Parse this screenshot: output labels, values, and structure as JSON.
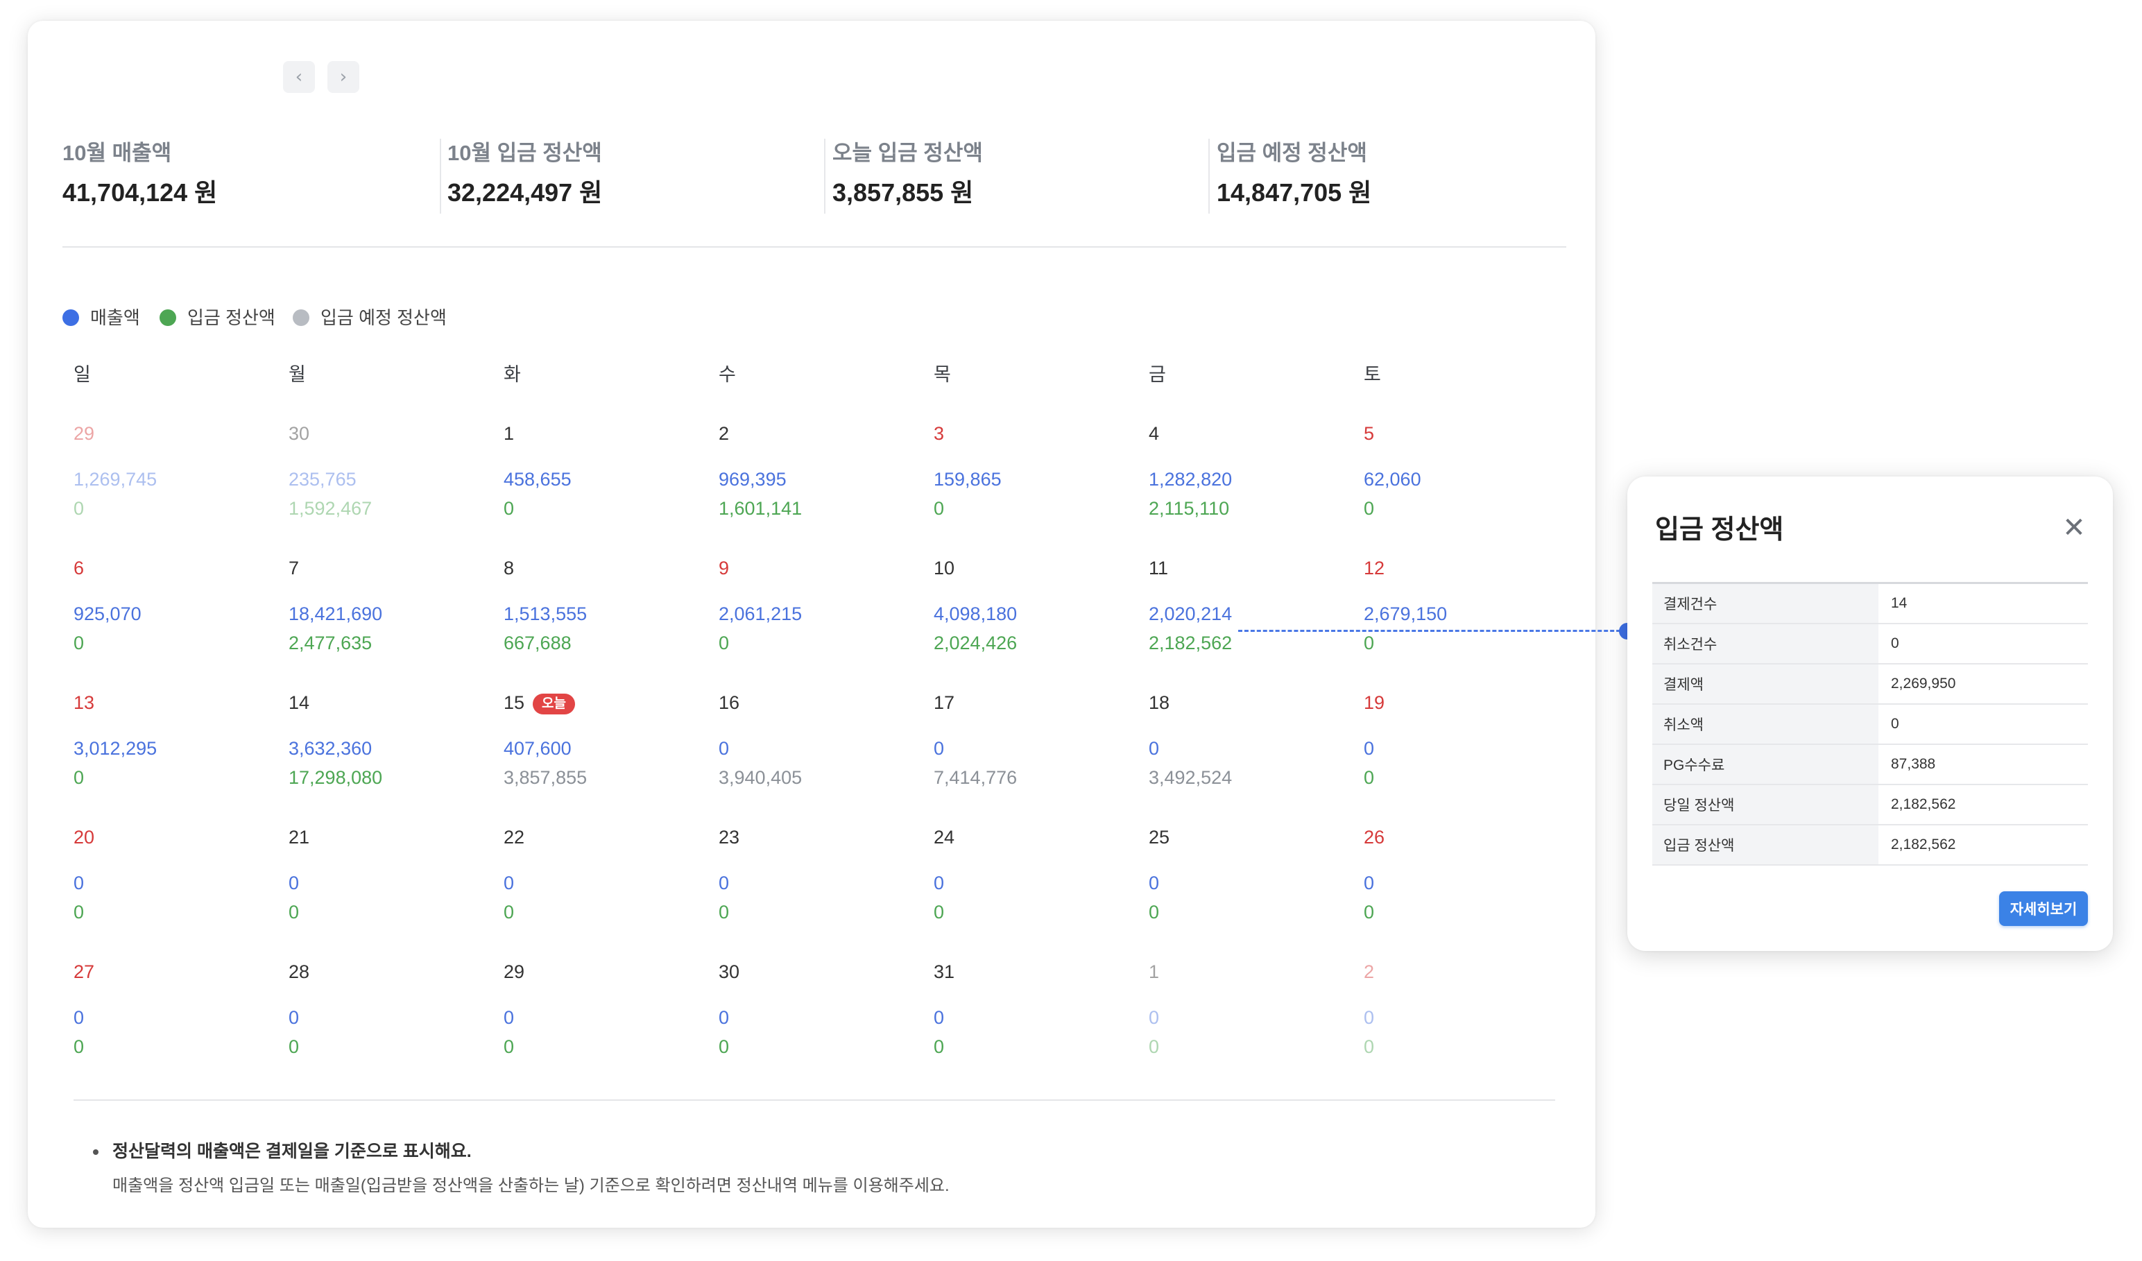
{
  "nav": {
    "prev": "‹",
    "next": "›"
  },
  "summary": [
    {
      "label": "10월 매출액",
      "value": "41,704,124 원"
    },
    {
      "label": "10월 입금 정산액",
      "value": "32,224,497 원"
    },
    {
      "label": "오늘 입금 정산액",
      "value": "3,857,855 원"
    },
    {
      "label": "입금 예정 정산액",
      "value": "14,847,705 원"
    }
  ],
  "legend": [
    {
      "label": "매출액",
      "color": "#3d6fe4"
    },
    {
      "label": "입금 정산액",
      "color": "#4da653"
    },
    {
      "label": "입금 예정 정산액",
      "color": "#b8bcc2"
    }
  ],
  "weekdays": [
    "일",
    "월",
    "화",
    "수",
    "목",
    "금",
    "토"
  ],
  "today_badge": "오늘",
  "weeks": [
    [
      {
        "day": "29",
        "sales": "1,269,745",
        "deposit": "0",
        "other": true
      },
      {
        "day": "30",
        "sales": "235,765",
        "deposit": "1,592,467",
        "other": true
      },
      {
        "day": "1",
        "sales": "458,655",
        "deposit": "0"
      },
      {
        "day": "2",
        "sales": "969,395",
        "deposit": "1,601,141"
      },
      {
        "day": "3",
        "sales": "159,865",
        "deposit": "0",
        "holiday": true
      },
      {
        "day": "4",
        "sales": "1,282,820",
        "deposit": "2,115,110"
      },
      {
        "day": "5",
        "sales": "62,060",
        "deposit": "0"
      }
    ],
    [
      {
        "day": "6",
        "sales": "925,070",
        "deposit": "0"
      },
      {
        "day": "7",
        "sales": "18,421,690",
        "deposit": "2,477,635"
      },
      {
        "day": "8",
        "sales": "1,513,555",
        "deposit": "667,688"
      },
      {
        "day": "9",
        "sales": "2,061,215",
        "deposit": "0",
        "holiday": true
      },
      {
        "day": "10",
        "sales": "4,098,180",
        "deposit": "2,024,426"
      },
      {
        "day": "11",
        "sales": "2,020,214",
        "deposit": "2,182,562"
      },
      {
        "day": "12",
        "sales": "2,679,150",
        "deposit": "0"
      }
    ],
    [
      {
        "day": "13",
        "sales": "3,012,295",
        "deposit": "0"
      },
      {
        "day": "14",
        "sales": "3,632,360",
        "deposit": "17,298,080"
      },
      {
        "day": "15",
        "sales": "407,600",
        "deposit": "3,857,855",
        "today": true,
        "scheduled": true
      },
      {
        "day": "16",
        "sales": "0",
        "deposit": "3,940,405",
        "scheduled": true
      },
      {
        "day": "17",
        "sales": "0",
        "deposit": "7,414,776",
        "scheduled": true
      },
      {
        "day": "18",
        "sales": "0",
        "deposit": "3,492,524",
        "scheduled": true
      },
      {
        "day": "19",
        "sales": "0",
        "deposit": "0"
      }
    ],
    [
      {
        "day": "20",
        "sales": "0",
        "deposit": "0"
      },
      {
        "day": "21",
        "sales": "0",
        "deposit": "0"
      },
      {
        "day": "22",
        "sales": "0",
        "deposit": "0"
      },
      {
        "day": "23",
        "sales": "0",
        "deposit": "0"
      },
      {
        "day": "24",
        "sales": "0",
        "deposit": "0"
      },
      {
        "day": "25",
        "sales": "0",
        "deposit": "0"
      },
      {
        "day": "26",
        "sales": "0",
        "deposit": "0"
      }
    ],
    [
      {
        "day": "27",
        "sales": "0",
        "deposit": "0"
      },
      {
        "day": "28",
        "sales": "0",
        "deposit": "0"
      },
      {
        "day": "29",
        "sales": "0",
        "deposit": "0"
      },
      {
        "day": "30",
        "sales": "0",
        "deposit": "0"
      },
      {
        "day": "31",
        "sales": "0",
        "deposit": "0"
      },
      {
        "day": "1",
        "sales": "0",
        "deposit": "0",
        "other": true
      },
      {
        "day": "2",
        "sales": "0",
        "deposit": "0",
        "other": true
      }
    ]
  ],
  "notice": {
    "main": "정산달력의 매출액은 결제일을 기준으로 표시해요.",
    "sub": "매출액을 정산액 입금일 또는 매출일(입금받을 정산액을 산출하는 날) 기준으로 확인하려면 정산내역 메뉴를 이용해주세요."
  },
  "popup": {
    "title": "입금 정산액",
    "close": "✕",
    "rows": [
      {
        "key": "결제건수",
        "value": "14"
      },
      {
        "key": "취소건수",
        "value": "0"
      },
      {
        "key": "결제액",
        "value": "2,269,950"
      },
      {
        "key": "취소액",
        "value": "0"
      },
      {
        "key": "PG수수료",
        "value": "87,388"
      },
      {
        "key": "당일 정산액",
        "value": "2,182,562"
      },
      {
        "key": "입금 정산액",
        "value": "2,182,562"
      }
    ],
    "button": "자세히보기"
  }
}
